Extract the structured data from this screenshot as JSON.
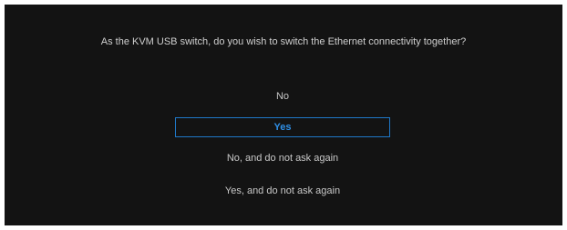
{
  "dialog": {
    "question": "As the KVM USB switch, do you wish to switch the Ethernet connectivity together?",
    "options": [
      {
        "label": "No",
        "selected": false
      },
      {
        "label": "Yes",
        "selected": true
      },
      {
        "label": "No, and do not ask again",
        "selected": false
      },
      {
        "label": "Yes, and do not ask again",
        "selected": false
      }
    ]
  },
  "colors": {
    "background": "#131313",
    "text": "#c8c8c8",
    "accent": "#2f8fe6",
    "selection_border": "#1f78c8"
  }
}
